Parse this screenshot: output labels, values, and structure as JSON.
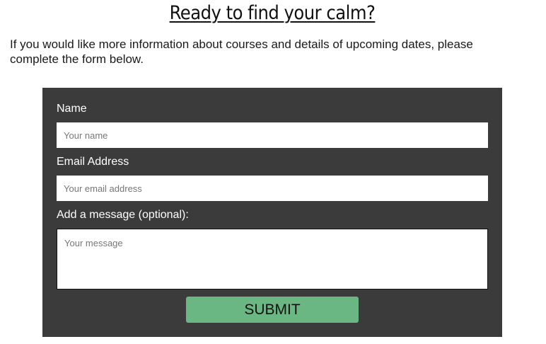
{
  "heading": "Ready to find your calm?",
  "intro_text": "If you would like more information about courses and details of upcoming dates, please complete the form below.",
  "form": {
    "name": {
      "label": "Name",
      "placeholder": "Your name",
      "value": ""
    },
    "email": {
      "label": "Email Address",
      "placeholder": "Your email address",
      "value": ""
    },
    "message": {
      "label": "Add a message (optional):",
      "placeholder": "Your message",
      "value": ""
    },
    "submit_label": "SUBMIT"
  },
  "colors": {
    "panel_background": "#3b3b3b",
    "submit_background": "#6ab783",
    "label_text": "#ffffff"
  }
}
